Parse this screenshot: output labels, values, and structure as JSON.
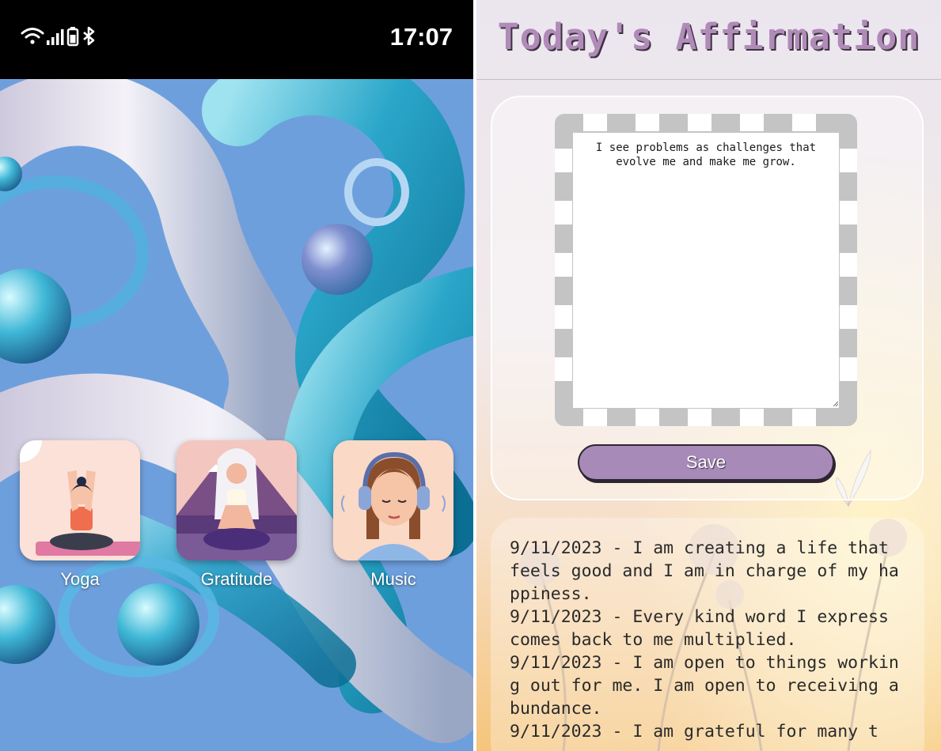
{
  "status_bar": {
    "time": "17:07",
    "icons": [
      "wifi-icon",
      "signal-icon",
      "battery-icon",
      "bluetooth-icon"
    ]
  },
  "home_screen": {
    "apps": [
      {
        "label": "Yoga",
        "icon": "yoga-icon"
      },
      {
        "label": "Gratitude",
        "icon": "gratitude-icon"
      },
      {
        "label": "Music",
        "icon": "music-icon"
      }
    ]
  },
  "affirmation_app": {
    "title": "Today's Affirmation",
    "affirmation_text": "I see problems as challenges that evolve me and make me grow.",
    "save_label": "Save",
    "history": [
      "9/11/2023 - I am creating a life that feels good and I am in charge of my happiness.",
      "9/11/2023 - Every kind word I express comes back to me multiplied.",
      "9/11/2023 - I am open to things working out for me. I am open to receiving abundance.",
      "9/11/2023 - I am grateful for many t"
    ]
  },
  "colors": {
    "wallpaper_blue": "#6e9fdd",
    "title_purple": "#b08bb8",
    "button_purple": "#a88ab9"
  }
}
